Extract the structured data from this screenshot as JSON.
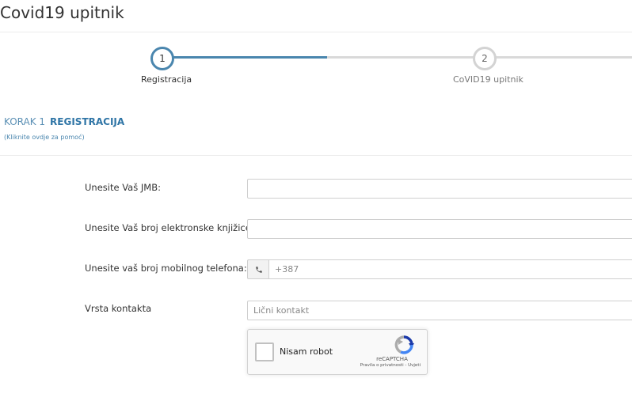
{
  "page": {
    "title": "Covid19 upitnik"
  },
  "stepper": {
    "steps": [
      {
        "number": "1",
        "label": "Registracija",
        "state": "active"
      },
      {
        "number": "2",
        "label": "CoVID19 upitnik",
        "state": "inactive"
      }
    ],
    "active_color": "#4a86ae",
    "inactive_color": "#d9d9d9"
  },
  "section": {
    "step_prefix": "KORAK 1",
    "step_title": "REGISTRACIJA",
    "help_link": "(Kliknite ovdje za pomoć)"
  },
  "form": {
    "jmb_label": "Unesite Vaš JMB:",
    "jmb_value": "",
    "card_label": "Unesite Vaš broj elektronske knjižice:",
    "card_value": "",
    "phone_label": "Unesite vaš broj mobilnog telefona:",
    "phone_icon": "phone-icon",
    "phone_placeholder": "+387",
    "contact_label": "Vrsta kontakta",
    "contact_placeholder": "Lični kontakt"
  },
  "recaptcha": {
    "checkbox_label": "Nisam robot",
    "brand": "reCAPTCHA",
    "terms": "Pravila o privatnosti - Uvjeti",
    "icon": "recaptcha-logo-icon"
  }
}
